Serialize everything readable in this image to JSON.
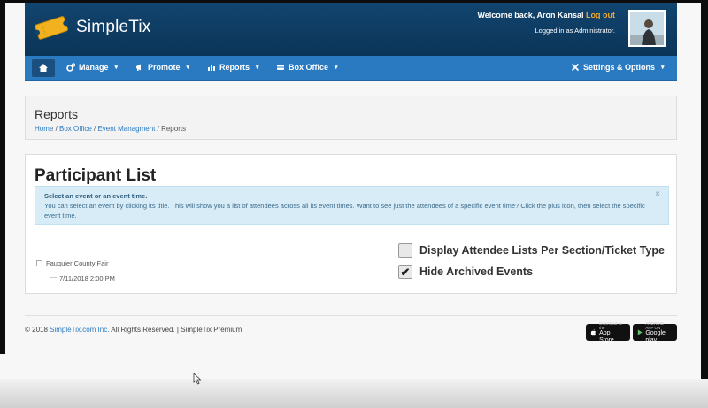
{
  "header": {
    "brand": "SimpleTix",
    "welcome_text": "Welcome back, Aron Kansal",
    "logout_label": "Log out",
    "logged_in_as": "Logged in as Administrator."
  },
  "nav": {
    "items": [
      {
        "label": "Manage",
        "icon": "gears-icon"
      },
      {
        "label": "Promote",
        "icon": "bullhorn-icon"
      },
      {
        "label": "Reports",
        "icon": "chart-icon"
      },
      {
        "label": "Box Office",
        "icon": "ticket-icon"
      }
    ],
    "settings_label": "Settings & Options",
    "caret": "▾"
  },
  "reports_panel": {
    "title": "Reports",
    "breadcrumb": {
      "home": "Home",
      "box_office": "Box Office",
      "event_mgmt": "Event Managment",
      "sep": " / ",
      "current": "Reports"
    }
  },
  "participant": {
    "heading": "Participant List",
    "alert_title": "Select an event or an event time.",
    "alert_body": "You can select an event by clicking its title. This will show you a list of attendees across all its event times. Want to see just the attendees of a specific event time? Click the plus icon, then select the specific event time.",
    "close": "×",
    "tree_event": "Fauquier County Fair",
    "tree_time": "7/11/2018 2:00 PM",
    "option_section": "Display Attendee Lists Per Section/Ticket Type",
    "option_archived": "Hide Archived Events",
    "check_mark": "✔"
  },
  "footer": {
    "copyright_prefix": "© 2018",
    "company": "SimpleTix.com Inc.",
    "rights": "All Rights Reserved. | SimpleTix Premium"
  },
  "badges": {
    "apple_small": "Download on the",
    "apple_big": "App Store",
    "google_small": "ANDROID APP ON",
    "google_big": "Google play"
  },
  "colors": {
    "header": "#11456f",
    "navbar": "#2a7ac2",
    "alert_bg": "#d8ecf7",
    "logout": "#f0a830"
  }
}
